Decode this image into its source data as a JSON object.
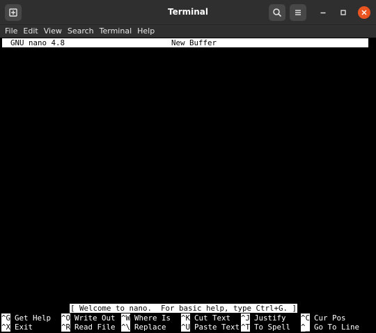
{
  "window": {
    "title": "Terminal"
  },
  "menubar": {
    "items": [
      "File",
      "Edit",
      "View",
      "Search",
      "Terminal",
      "Help"
    ]
  },
  "nano": {
    "version": "GNU nano 4.8",
    "buffer": "New Buffer",
    "status": "[ Welcome to nano.  For basic help, type Ctrl+G. ]",
    "shortcuts_row1": [
      {
        "key": "^G",
        "label": "Get Help"
      },
      {
        "key": "^O",
        "label": "Write Out"
      },
      {
        "key": "^W",
        "label": "Where Is"
      },
      {
        "key": "^K",
        "label": "Cut Text"
      },
      {
        "key": "^J",
        "label": "Justify"
      },
      {
        "key": "^C",
        "label": "Cur Pos"
      }
    ],
    "shortcuts_row2": [
      {
        "key": "^X",
        "label": "Exit"
      },
      {
        "key": "^R",
        "label": "Read File"
      },
      {
        "key": "^\\",
        "label": "Replace"
      },
      {
        "key": "^U",
        "label": "Paste Text"
      },
      {
        "key": "^T",
        "label": "To Spell"
      },
      {
        "key": "^_",
        "label": "Go To Line"
      }
    ]
  },
  "icons": {
    "new_tab": "new-tab-icon",
    "search": "search-icon",
    "menu": "hamburger-menu-icon",
    "minimize": "minimize-icon",
    "maximize": "maximize-icon",
    "close": "close-icon"
  },
  "colors": {
    "titlebar": "#2f2f2f",
    "terminal_bg": "#000000",
    "terminal_fg": "#ffffff",
    "close_button": "#e95420"
  }
}
